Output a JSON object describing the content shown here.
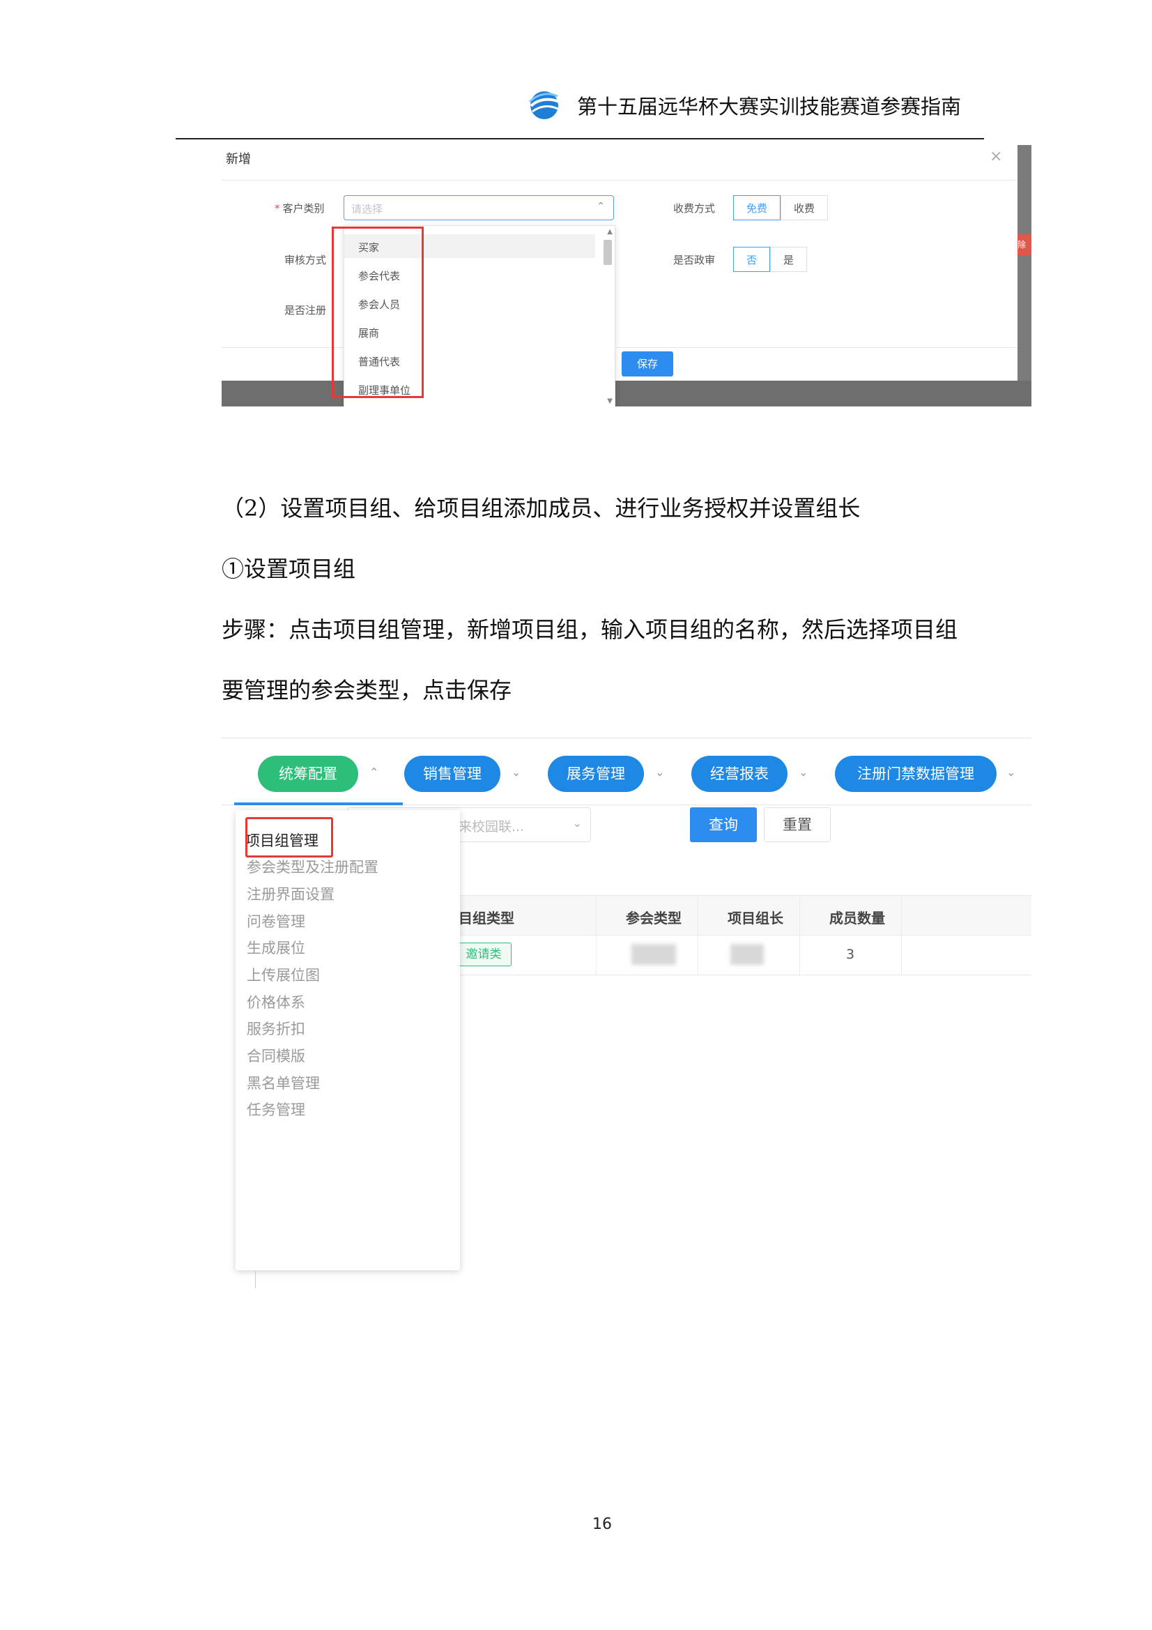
{
  "header": {
    "title": "第十五届远华杯大赛实训技能赛道参赛指南",
    "logo_icon": "swoosh-globe-logo-icon"
  },
  "dialog": {
    "title": "新增",
    "close_icon": "close-icon",
    "customer_type_label": "客户类别",
    "required_mark": "*",
    "select_placeholder": "请选择",
    "review_label": "审核方式",
    "register_label": "是否注册",
    "fee_label": "收费方式",
    "fee_options": [
      "免费",
      "收费"
    ],
    "gov_label": "是否政审",
    "gov_options": [
      "否",
      "是"
    ],
    "save": "保存",
    "dropdown_items": [
      "买家",
      "参会代表",
      "参会人员",
      "展商",
      "普通代表",
      "副理事单位"
    ],
    "edge_text": "除"
  },
  "body": {
    "line1": "（2）设置项目组、给项目组添加成员、进行业务授权并设置组长",
    "line2": "①设置项目组",
    "line3": "步骤：点击项目组管理，新增项目组，输入项目组的名称，然后选择项目组",
    "line4": "要管理的参会类型，点击保存"
  },
  "app": {
    "nav": [
      "统筹配置",
      "销售管理",
      "展务管理",
      "经营报表",
      "注册门禁数据管理"
    ],
    "filter_text": "未来校园联...",
    "query": "查询",
    "reset": "重置",
    "columns": [
      "目组类型",
      "参会类型",
      "项目组长",
      "成员数量"
    ],
    "row": {
      "type_tag": "邀请类",
      "member_count": "3"
    },
    "menu": [
      "项目组管理",
      "参会类型及注册配置",
      "注册界面设置",
      "问卷管理",
      "生成展位",
      "上传展位图",
      "价格体系",
      "服务折扣",
      "合同模版",
      "黑名单管理",
      "任务管理"
    ]
  },
  "page_number": "16",
  "colors": {
    "primary": "#2d8cf0",
    "green": "#2dbf7a",
    "highlight": "#e53935"
  }
}
